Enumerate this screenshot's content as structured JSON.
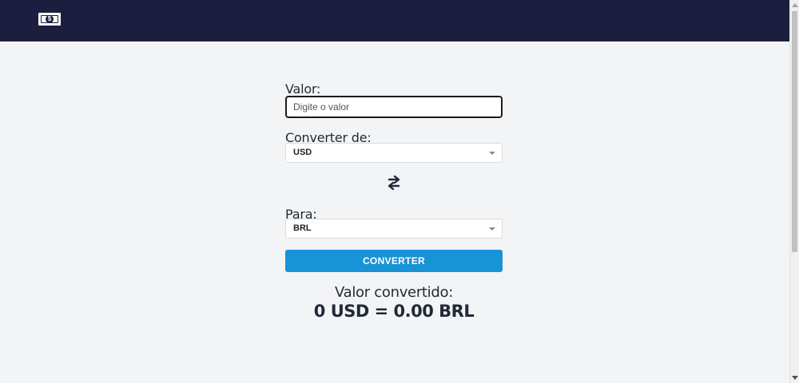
{
  "header": {
    "logo_icon": "money-bill-icon",
    "logo_mark": "$"
  },
  "form": {
    "amount_label": "Valor:",
    "amount_placeholder": "Digite o valor",
    "amount_value": "",
    "from_label": "Converter de:",
    "from_value": "USD",
    "swap_icon": "swap-arrows-icon",
    "to_label": "Para:",
    "to_value": "BRL",
    "convert_button": "CONVERTER"
  },
  "result": {
    "title": "Valor convertido:",
    "value": "0 USD = 0.00 BRL"
  },
  "colors": {
    "topbar": "#1c1e3f",
    "background": "#f3f4f6",
    "button": "#1793d6",
    "text": "#1f2a36"
  }
}
